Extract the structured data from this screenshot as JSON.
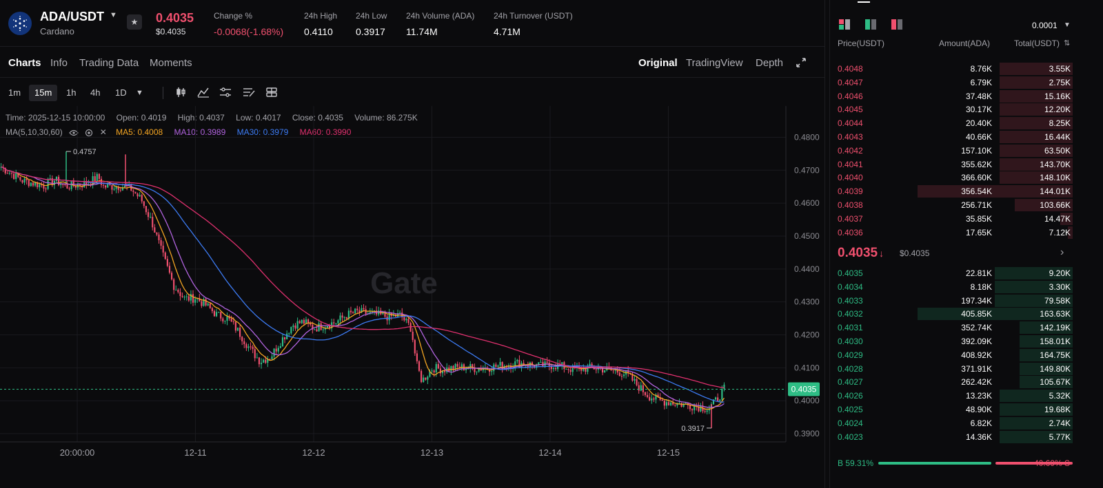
{
  "ticker": {
    "pair": "ADA/USDT",
    "coin_name": "Cardano",
    "last_price": "0.4035",
    "last_price_usd": "$0.4035",
    "stats": [
      {
        "label": "Change %",
        "value": "-0.0068(-1.68%)",
        "negative": true
      },
      {
        "label": "24h High",
        "value": "0.4110"
      },
      {
        "label": "24h Low",
        "value": "0.3917"
      },
      {
        "label": "24h Volume (ADA)",
        "value": "11.74M"
      },
      {
        "label": "24h Turnover (USDT)",
        "value": "4.71M"
      }
    ]
  },
  "tabs": {
    "left": [
      "Charts",
      "Info",
      "Trading Data",
      "Moments"
    ],
    "right": [
      "Original",
      "TradingView",
      "Depth"
    ]
  },
  "toolbar": {
    "timeframes": [
      "1m",
      "15m",
      "1h",
      "4h",
      "1D"
    ],
    "selected": "15m"
  },
  "legend": {
    "time": "Time: 2025-12-15 10:00:00",
    "open": "Open: 0.4019",
    "high": "High: 0.4037",
    "low": "Low: 0.4017",
    "close": "Close: 0.4035",
    "volume": "Volume: 86.275K",
    "ma_label": "MA(5,10,30,60)",
    "ma5": "MA5: 0.4008",
    "ma10": "MA10: 0.3989",
    "ma30": "MA30: 0.3979",
    "ma60": "MA60: 0.3990"
  },
  "colors": {
    "up": "#2ebd85",
    "down": "#f0506e",
    "ma5": "#f5a623",
    "ma10": "#b264e0",
    "ma30": "#3d7cf5",
    "ma60": "#e0306e"
  },
  "chart_data": {
    "type": "candlestick",
    "watermark": "Gate",
    "x_ticks": [
      "20:00:00",
      "12-11",
      "12-12",
      "12-13",
      "12-14",
      "12-15"
    ],
    "y_ticks": [
      "0.4800",
      "0.4700",
      "0.4600",
      "0.4500",
      "0.4400",
      "0.4300",
      "0.4200",
      "0.4100",
      "0.4000",
      "0.3900"
    ],
    "ylim": [
      0.3875,
      0.4895
    ],
    "current_price_label": "0.4035",
    "max_label": "0.4757",
    "min_label": "0.3917",
    "approx_close_path": [
      [
        0,
        0.471
      ],
      [
        4,
        0.4668
      ],
      [
        8,
        0.4653
      ],
      [
        10,
        0.467
      ],
      [
        12,
        0.465
      ],
      [
        14,
        0.4655
      ],
      [
        16,
        0.466
      ],
      [
        18,
        0.468
      ],
      [
        19,
        0.465
      ],
      [
        22,
        0.4652
      ],
      [
        24,
        0.4645
      ],
      [
        26,
        0.461
      ],
      [
        28,
        0.454
      ],
      [
        30,
        0.444
      ],
      [
        32,
        0.435
      ],
      [
        34,
        0.431
      ],
      [
        36,
        0.4312
      ],
      [
        38,
        0.429
      ],
      [
        40,
        0.426
      ],
      [
        42,
        0.425
      ],
      [
        44,
        0.421
      ],
      [
        46,
        0.416
      ],
      [
        48,
        0.412
      ],
      [
        50,
        0.4135
      ],
      [
        52,
        0.4185
      ],
      [
        54,
        0.423
      ],
      [
        56,
        0.424
      ],
      [
        58,
        0.422
      ],
      [
        60,
        0.423
      ],
      [
        62,
        0.4238
      ],
      [
        64,
        0.426
      ],
      [
        66,
        0.427
      ],
      [
        68,
        0.4265
      ],
      [
        70,
        0.426
      ],
      [
        72,
        0.4255
      ],
      [
        74,
        0.426
      ],
      [
        76,
        0.422
      ],
      [
        77,
        0.411
      ],
      [
        78,
        0.406
      ],
      [
        80,
        0.41
      ],
      [
        82,
        0.4095
      ],
      [
        84,
        0.41
      ],
      [
        86,
        0.4102
      ],
      [
        88,
        0.4098
      ],
      [
        90,
        0.41
      ],
      [
        92,
        0.4105
      ],
      [
        94,
        0.411
      ],
      [
        96,
        0.4115
      ],
      [
        98,
        0.411
      ],
      [
        100,
        0.4105
      ],
      [
        102,
        0.4108
      ],
      [
        104,
        0.4104
      ],
      [
        106,
        0.4095
      ],
      [
        108,
        0.4098
      ],
      [
        110,
        0.41
      ],
      [
        112,
        0.4095
      ],
      [
        114,
        0.409
      ],
      [
        116,
        0.408
      ],
      [
        118,
        0.4045
      ],
      [
        120,
        0.4015
      ],
      [
        122,
        0.4
      ],
      [
        124,
        0.3995
      ],
      [
        126,
        0.399
      ],
      [
        128,
        0.3985
      ],
      [
        130,
        0.398
      ],
      [
        131,
        0.3975
      ],
      [
        132,
        0.399
      ],
      [
        134,
        0.4035
      ]
    ]
  },
  "orderbook": {
    "precision": "0.0001",
    "headers": {
      "price": "Price(USDT)",
      "amount": "Amount(ADA)",
      "total": "Total(USDT)"
    },
    "asks": [
      {
        "price": "0.4048",
        "amount": "8.76K",
        "total": "3.55K",
        "depth": 0.3
      },
      {
        "price": "0.4047",
        "amount": "6.79K",
        "total": "2.75K",
        "depth": 0.3
      },
      {
        "price": "0.4046",
        "amount": "37.48K",
        "total": "15.16K",
        "depth": 0.3
      },
      {
        "price": "0.4045",
        "amount": "30.17K",
        "total": "12.20K",
        "depth": 0.3
      },
      {
        "price": "0.4044",
        "amount": "20.40K",
        "total": "8.25K",
        "depth": 0.3
      },
      {
        "price": "0.4043",
        "amount": "40.66K",
        "total": "16.44K",
        "depth": 0.3
      },
      {
        "price": "0.4042",
        "amount": "157.10K",
        "total": "63.50K",
        "depth": 0.3
      },
      {
        "price": "0.4041",
        "amount": "355.62K",
        "total": "143.70K",
        "depth": 0.3
      },
      {
        "price": "0.4040",
        "amount": "366.60K",
        "total": "148.10K",
        "depth": 0.3
      },
      {
        "price": "0.4039",
        "amount": "356.54K",
        "total": "144.01K",
        "depth": 0.64
      },
      {
        "price": "0.4038",
        "amount": "256.71K",
        "total": "103.66K",
        "depth": 0.24
      },
      {
        "price": "0.4037",
        "amount": "35.85K",
        "total": "14.47K",
        "depth": 0.05
      },
      {
        "price": "0.4036",
        "amount": "17.65K",
        "total": "7.12K",
        "depth": 0.02
      }
    ],
    "mid": {
      "price": "0.4035",
      "usd": "$0.4035"
    },
    "bids": [
      {
        "price": "0.4035",
        "amount": "22.81K",
        "total": "9.20K",
        "depth": 0.32
      },
      {
        "price": "0.4034",
        "amount": "8.18K",
        "total": "3.30K",
        "depth": 0.32
      },
      {
        "price": "0.4033",
        "amount": "197.34K",
        "total": "79.58K",
        "depth": 0.32
      },
      {
        "price": "0.4032",
        "amount": "405.85K",
        "total": "163.63K",
        "depth": 0.64
      },
      {
        "price": "0.4031",
        "amount": "352.74K",
        "total": "142.19K",
        "depth": 0.22
      },
      {
        "price": "0.4030",
        "amount": "392.09K",
        "total": "158.01K",
        "depth": 0.22
      },
      {
        "price": "0.4029",
        "amount": "408.92K",
        "total": "164.75K",
        "depth": 0.22
      },
      {
        "price": "0.4028",
        "amount": "371.91K",
        "total": "149.80K",
        "depth": 0.22
      },
      {
        "price": "0.4027",
        "amount": "262.42K",
        "total": "105.67K",
        "depth": 0.22
      },
      {
        "price": "0.4026",
        "amount": "13.23K",
        "total": "5.32K",
        "depth": 0.3
      },
      {
        "price": "0.4025",
        "amount": "48.90K",
        "total": "19.68K",
        "depth": 0.3
      },
      {
        "price": "0.4024",
        "amount": "6.82K",
        "total": "2.74K",
        "depth": 0.3
      },
      {
        "price": "0.4023",
        "amount": "14.36K",
        "total": "5.77K",
        "depth": 0.3
      }
    ],
    "buy_ratio": "59.31%",
    "sell_ratio": "40.69%",
    "buy_fraction": 0.5931,
    "buy_label": "B",
    "sell_label": "S"
  }
}
